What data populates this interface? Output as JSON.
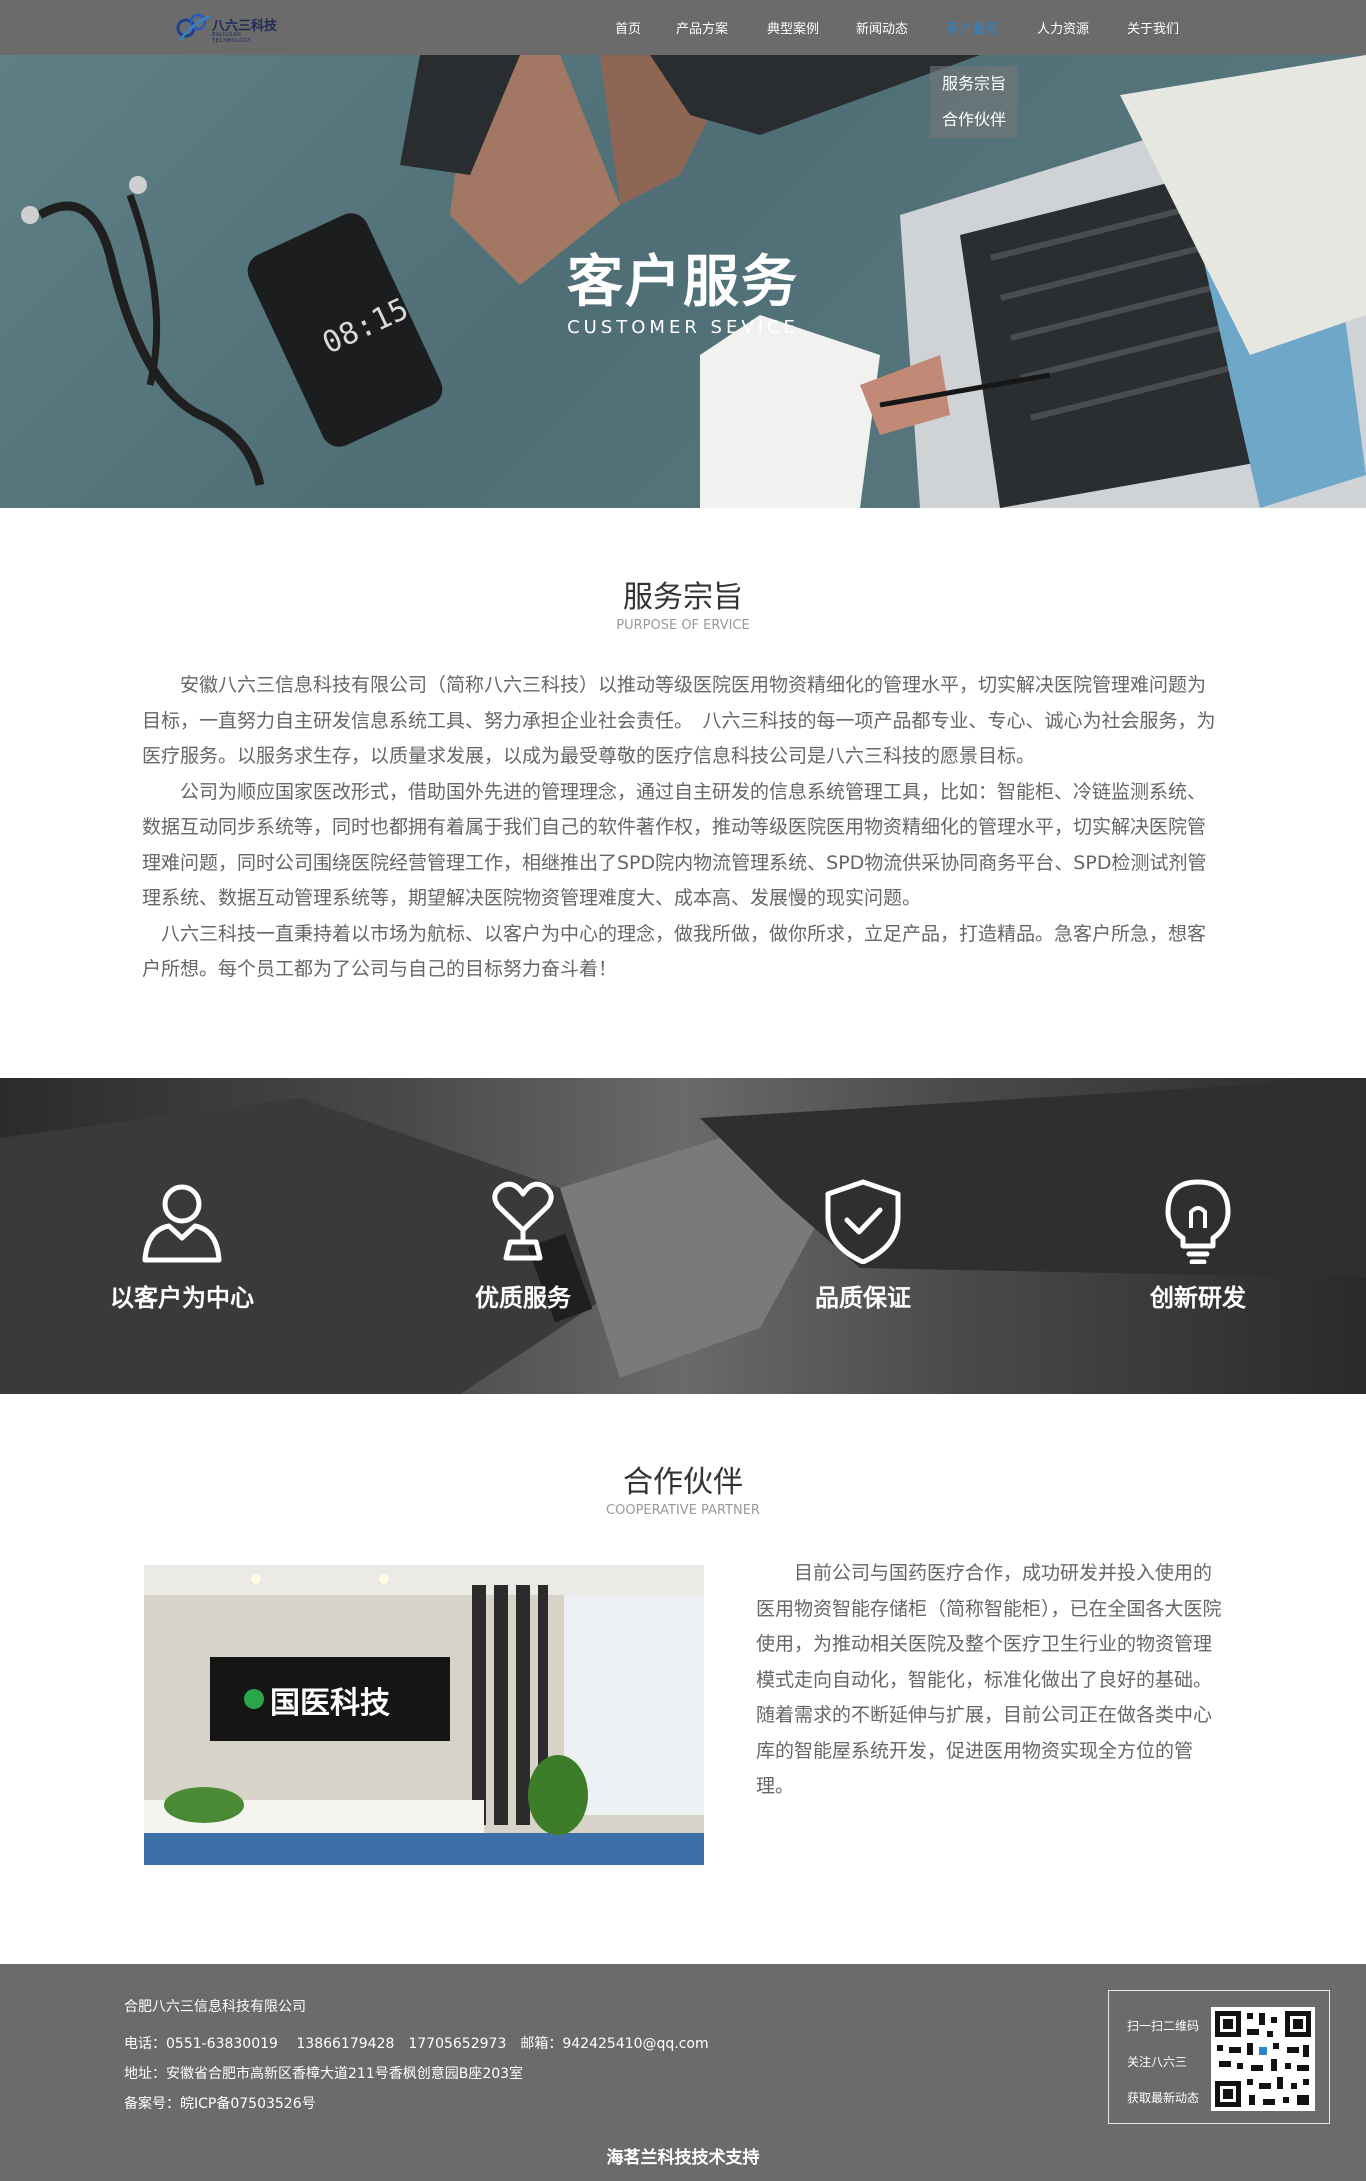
{
  "nav": {
    "logo_text": "八六三科技",
    "logo_sub": "BALIUSAN TECHNOLOGY",
    "items": [
      {
        "label": "首页"
      },
      {
        "label": "产品方案"
      },
      {
        "label": "典型案例"
      },
      {
        "label": "新闻动态"
      },
      {
        "label": "客户服务",
        "active": true
      },
      {
        "label": "人力资源"
      },
      {
        "label": "关于我们"
      }
    ],
    "dropdown": [
      {
        "label": "服务宗旨"
      },
      {
        "label": "合作伙伴"
      }
    ]
  },
  "hero": {
    "title": "客户服务",
    "subtitle": "CUSTOMER  SEVICE",
    "phone_time": "08:15"
  },
  "purpose": {
    "title": "服务宗旨",
    "subtitle": "PURPOSE OF ERVICE",
    "paragraphs": [
      "　　安徽八六三信息科技有限公司（简称八六三科技）以推动等级医院医用物资精细化的管理水平，切实解决医院管理难问题为目标，一直努力自主研发信息系统工具、努力承担企业社会责任。　八六三科技的每一项产品都专业、专心、诚心为社会服务，为医疗服务。以服务求生存，以质量求发展，以成为最受尊敬的医疗信息科技公司是八六三科技的愿景目标。",
      "　　公司为顺应国家医改形式，借助国外先进的管理理念，通过自主研发的信息系统管理工具，比如：智能柜、冷链监测系统、数据互动同步系统等，同时也都拥有着属于我们自己的软件著作权，推动等级医院医用物资精细化的管理水平，切实解决医院管理难问题，同时公司围绕医院经营管理工作，相继推出了SPD院内物流管理系统、SPD物流供采协同商务平台、SPD检测试剂管理系统、数据互动管理系统等，期望解决医院物资管理难度大、成本高、发展慢的现实问题。",
      "　八六三科技一直秉持着以市场为航标、以客户为中心的理念，做我所做，做你所求，立足产品，打造精品。急客户所急，想客户所想。每个员工都为了公司与自己的目标努力奋斗着！"
    ]
  },
  "values": [
    {
      "label": "以客户为中心",
      "icon": "user-icon"
    },
    {
      "label": "优质服务",
      "icon": "heart-trophy-icon"
    },
    {
      "label": "品质保证",
      "icon": "shield-check-icon"
    },
    {
      "label": "创新研发",
      "icon": "lightbulb-icon"
    }
  ],
  "partner": {
    "title": "合作伙伴",
    "subtitle": "COOPERATIVE PARTNER",
    "sign_text": "国医科技",
    "text": "　　目前公司与国药医疗合作，成功研发并投入使用的医用物资智能存储柜（简称智能柜），已在全国各大医院使用，为推动相关医院及整个医疗卫生行业的物资管理模式走向自动化，智能化，标准化做出了良好的基础。随着需求的不断延伸与扩展，目前公司正在做各类中心库的智能屋系统开发，促进医用物资实现全方位的管理。"
  },
  "footer": {
    "company": "合肥八六三信息科技有限公司",
    "contact": "电话：0551-63830019　 13866179428　17705652973　邮箱：942425410@qq.com",
    "address": "地址：安徽省合肥市高新区香樟大道211号香枫创意园B座203室",
    "icp": "备案号：皖ICP备07503526号",
    "qr_lines": [
      "扫一扫二维码",
      "关注八六三",
      "获取最新动态"
    ],
    "powered": "海茗兰科技技术支持"
  },
  "colors": {
    "nav_bg": "#6b6b6b",
    "active": "#2e86c9",
    "footer_bg": "#6b6b6b"
  }
}
